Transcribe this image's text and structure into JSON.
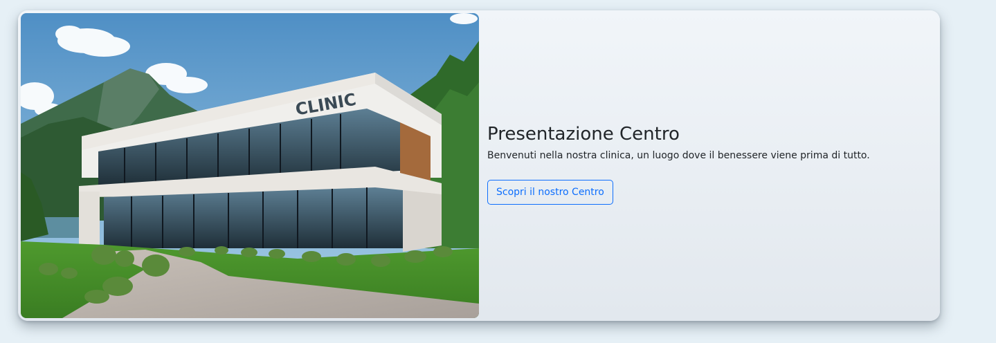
{
  "hero": {
    "image": {
      "alt": "Modern clinic building with mountains",
      "sign_text": "CLINIC"
    },
    "title": "Presentazione Centro",
    "subtitle": "Benvenuti nella nostra clinica, un luogo dove il benessere viene prima di tutto.",
    "button_label": "Scopri il nostro Centro"
  },
  "colors": {
    "page_bg": "#e6f0f6",
    "card_bg": "#eef2f6",
    "accent": "#0d6efd",
    "text": "#212529"
  }
}
